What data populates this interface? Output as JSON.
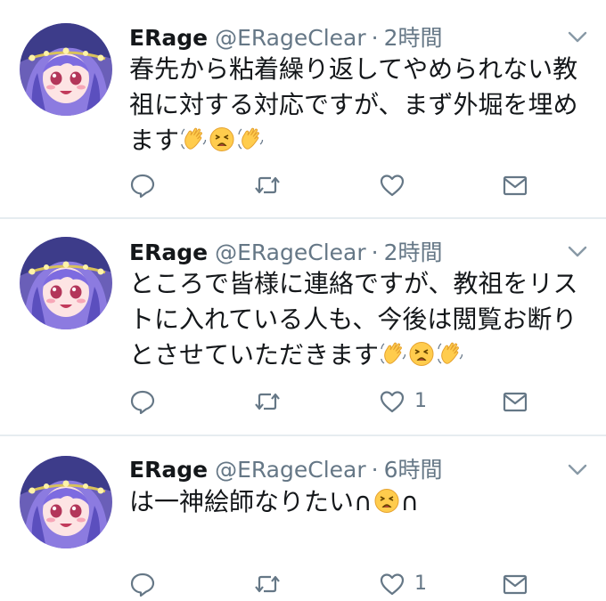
{
  "tweets": [
    {
      "name": "ERage",
      "handle": "@ERageClear",
      "separator": "·",
      "time": "2時間",
      "text_lines": [
        "春先から粘着繰り返してやめられない教",
        "祖に対する対応ですが、まず外堀を埋め",
        "ます"
      ],
      "emoji": [
        "waving-hands-icon",
        "tired-face-icon",
        "waving-hands-icon"
      ],
      "like_count": ""
    },
    {
      "name": "ERage",
      "handle": "@ERageClear",
      "separator": "·",
      "time": "2時間",
      "text_lines": [
        "ところで皆様に連絡ですが、教祖をリス",
        "トに入れている人も、今後は閲覧お断り",
        "とさせていただきます"
      ],
      "emoji": [
        "waving-hands-icon",
        "tired-face-icon",
        "waving-hands-icon"
      ],
      "like_count": "1"
    },
    {
      "name": "ERage",
      "handle": "@ERageClear",
      "separator": "·",
      "time": "6時間",
      "text_before": "は一神絵師なりたい∩",
      "text_after": "∩",
      "emoji": [
        "tired-face-icon"
      ],
      "like_count": "1"
    }
  ],
  "colors": {
    "text": "#14171a",
    "secondary": "#657786",
    "divider": "#e6ecf0",
    "emoji_yellow": "#ffcc4d"
  }
}
